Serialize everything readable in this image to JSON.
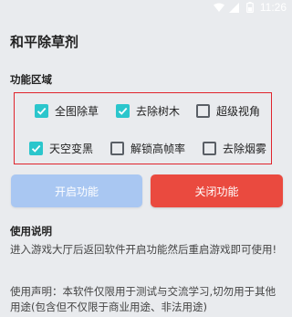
{
  "status_bar": {
    "time": "11:26",
    "icons": [
      "wifi-icon",
      "signal-icon",
      "battery-icon"
    ]
  },
  "page": {
    "title": "和平除草剂"
  },
  "features": {
    "section_title": "功能区域",
    "options": [
      {
        "label": "全图除草",
        "checked": true
      },
      {
        "label": "去除树木",
        "checked": true
      },
      {
        "label": "超级视角",
        "checked": false
      },
      {
        "label": "天空变黑",
        "checked": true
      },
      {
        "label": "解锁高帧率",
        "checked": false
      },
      {
        "label": "去除烟雾",
        "checked": false
      }
    ],
    "checkbox_color": "#2bc6cc",
    "border_color": "#e0242c"
  },
  "buttons": {
    "start_label": "开启功能",
    "stop_label": "关闭功能",
    "start_color": "#a9c7f2",
    "stop_color": "#ea4a3f"
  },
  "usage": {
    "title": "使用说明",
    "text": "进入游戏大厅后返回软件开启功能然后重启游戏即可使用!",
    "disclaimer": "使用声明：本软件仅限用于测试与交流学习,切勿用于其他用途(包含但不仅限于商业用途、非法用途)"
  }
}
